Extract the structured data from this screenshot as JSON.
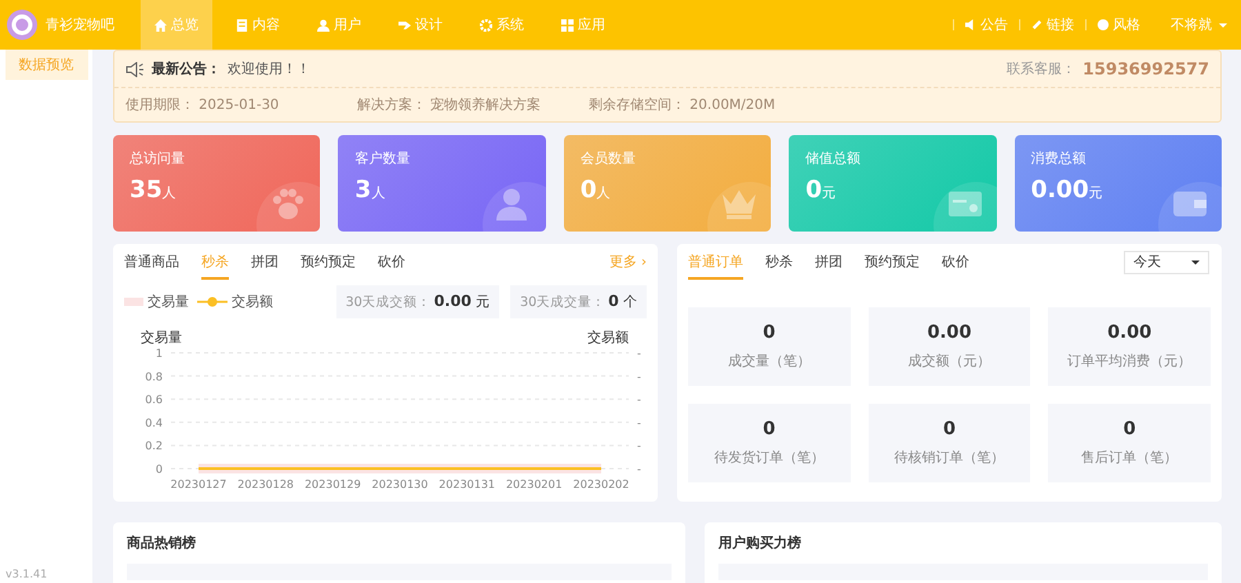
{
  "logo": {
    "title": "青衫宠物吧"
  },
  "nav": [
    {
      "label": "总览",
      "selected": true
    },
    {
      "label": "内容",
      "selected": false
    },
    {
      "label": "用户",
      "selected": false
    },
    {
      "label": "设计",
      "selected": false
    },
    {
      "label": "系统",
      "selected": false
    },
    {
      "label": "应用",
      "selected": false
    }
  ],
  "header_links": [
    {
      "label": "公告"
    },
    {
      "label": "链接"
    },
    {
      "label": "风格"
    }
  ],
  "user_menu": {
    "label": "不将就"
  },
  "sidebar": {
    "items": [
      {
        "label": "数据预览",
        "selected": true
      }
    ]
  },
  "version": "v3.1.41",
  "notice": {
    "title": "最新公告：",
    "message": "欢迎使用！！",
    "contact_label": "联系客服：",
    "contact": "15936992577",
    "details": [
      {
        "label": "使用期限：",
        "value": "2025-01-30"
      },
      {
        "label": "解决方案：",
        "value": "宠物领养解决方案"
      },
      {
        "label": "剩余存储空间：",
        "value": "20.00M/20M"
      }
    ]
  },
  "stats": [
    {
      "label": "总访问量",
      "value": "35",
      "unit": "人",
      "color": "#f0675a"
    },
    {
      "label": "客户数量",
      "value": "3",
      "unit": "人",
      "color": "#7866f5"
    },
    {
      "label": "会员数量",
      "value": "0",
      "unit": "人",
      "color": "#f3ad3f"
    },
    {
      "label": "储值总额",
      "value": "0",
      "unit": "元",
      "color": "#13c9a7"
    },
    {
      "label": "消费总额",
      "value": "0.00",
      "unit": "元",
      "color": "#5f80f2"
    }
  ],
  "goods_panel": {
    "tabs": [
      {
        "label": "普通商品",
        "selected": false
      },
      {
        "label": "秒杀",
        "selected": true
      },
      {
        "label": "拼团",
        "selected": false
      },
      {
        "label": "预约预定",
        "selected": false
      },
      {
        "label": "砍价",
        "selected": false
      }
    ],
    "more": "更多 ›",
    "summary": [
      {
        "label": "30天成交额：",
        "value": "0.00",
        "unit": "元"
      },
      {
        "label": "30天成交量：",
        "value": "0",
        "unit": "个"
      }
    ],
    "right_axis": {
      "label": "交易额",
      "ticks": [
        "-",
        "-",
        "-",
        "-",
        "-",
        "-"
      ]
    },
    "chart_data": {
      "type": "line",
      "grid": true,
      "legend": "top-left",
      "ylabel": "交易量",
      "categories": [
        "20230127",
        "20230128",
        "20230129",
        "20230130",
        "20230131",
        "20230201",
        "20230202"
      ],
      "ylim": [
        0,
        1
      ],
      "yticks": [
        0,
        0.2,
        0.4,
        0.6,
        0.8,
        1
      ],
      "series": [
        {
          "name": "交易量",
          "color": "#fbe3e3",
          "values": [
            0,
            0,
            0,
            0,
            0,
            0,
            0
          ]
        },
        {
          "name": "交易额",
          "color": "#fbbf24",
          "values": [
            0,
            0,
            0,
            0,
            0,
            0,
            0
          ]
        }
      ]
    }
  },
  "orders_panel": {
    "tabs": [
      {
        "label": "普通订单",
        "selected": true
      },
      {
        "label": "秒杀",
        "selected": false
      },
      {
        "label": "拼团",
        "selected": false
      },
      {
        "label": "预约预定",
        "selected": false
      },
      {
        "label": "砍价",
        "selected": false
      }
    ],
    "period": "今天",
    "tiles": [
      {
        "value": "0",
        "label": "成交量（笔）"
      },
      {
        "value": "0.00",
        "label": "成交额（元）"
      },
      {
        "value": "0.00",
        "label": "订单平均消费（元）"
      },
      {
        "value": "0",
        "label": "待发货订单（笔）"
      },
      {
        "value": "0",
        "label": "待核销订单（笔）"
      },
      {
        "value": "0",
        "label": "售后订单（笔）"
      }
    ]
  },
  "rankings": [
    {
      "title": "商品热销榜"
    },
    {
      "title": "用户购买力榜"
    }
  ]
}
